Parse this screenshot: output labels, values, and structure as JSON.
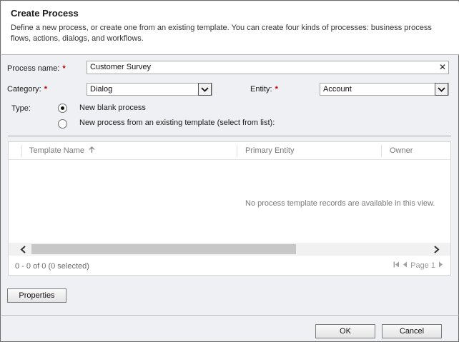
{
  "dialog": {
    "title": "Create Process",
    "description": "Define a new process, or create one from an existing template. You can create four kinds of processes: business process flows, actions, dialogs, and workflows."
  },
  "form": {
    "process_name": {
      "label": "Process name:",
      "value": "Customer Survey",
      "required": "*"
    },
    "category": {
      "label": "Category:",
      "value": "Dialog",
      "required": "*"
    },
    "entity": {
      "label": "Entity:",
      "value": "Account",
      "required": "*"
    },
    "type": {
      "label": "Type:",
      "options": [
        {
          "label": "New blank process",
          "checked": true
        },
        {
          "label": "New process from an existing template (select from list):",
          "checked": false
        }
      ]
    }
  },
  "grid": {
    "columns": [
      {
        "label": "Template Name",
        "sort": "ascending"
      },
      {
        "label": "Primary Entity"
      },
      {
        "label": "Owner"
      }
    ],
    "empty_message": "No process template records are available in this view.",
    "record_count": "0 - 0 of 0 (0 selected)",
    "page_label": "Page 1"
  },
  "buttons": {
    "properties": "Properties",
    "ok": "OK",
    "cancel": "Cancel"
  },
  "icons": {
    "clear": "close-icon",
    "dropdown": "chevron-down-icon",
    "sort": "arrow-up-icon",
    "scroll_left": "chevron-left-icon",
    "scroll_right": "chevron-right-icon",
    "first_page": "first-page-icon",
    "prev_page": "previous-page-icon",
    "next_page": "next-page-icon"
  },
  "colors": {
    "required": "#c00000",
    "dialog_background": "#eef0f3",
    "header_background": "#ffffff"
  }
}
